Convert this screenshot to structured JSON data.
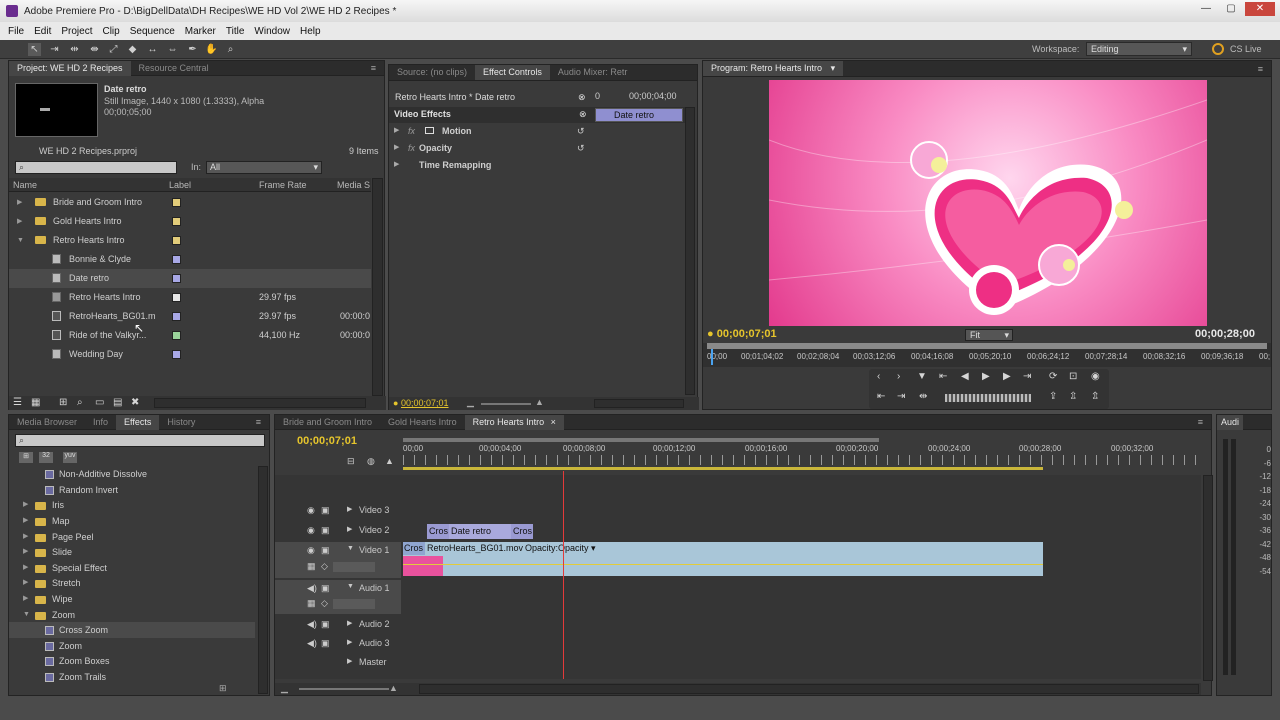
{
  "window": {
    "title": "Adobe Premiere Pro - D:\\BigDellData\\DH Recipes\\WE HD Vol 2\\WE HD 2 Recipes *"
  },
  "menu": [
    "File",
    "Edit",
    "Project",
    "Clip",
    "Sequence",
    "Marker",
    "Title",
    "Window",
    "Help"
  ],
  "workspace": {
    "label": "Workspace:",
    "value": "Editing",
    "cslive": "CS Live"
  },
  "project": {
    "tabs": [
      "Project: WE HD 2 Recipes",
      "Resource Central"
    ],
    "preview": {
      "name": "Date retro",
      "info": "Still Image, 1440 x 1080 (1.3333), Alpha",
      "duration": "00;00;05;00"
    },
    "file": "WE HD 2 Recipes.prproj",
    "count": "9 Items",
    "in_label": "In:",
    "in_value": "All",
    "columns": [
      "Name",
      "Label",
      "Frame Rate",
      "Media S"
    ],
    "items": [
      {
        "name": "Bride and Groom Intro",
        "rate": "",
        "media": ""
      },
      {
        "name": "Gold Hearts Intro",
        "rate": "",
        "media": ""
      },
      {
        "name": "Retro Hearts Intro",
        "rate": "",
        "media": ""
      },
      {
        "name": "Bonnie & Clyde",
        "rate": "",
        "media": ""
      },
      {
        "name": "Date retro",
        "rate": "",
        "media": ""
      },
      {
        "name": "Retro Hearts Intro",
        "rate": "29.97 fps",
        "media": ""
      },
      {
        "name": "RetroHearts_BG01.m",
        "rate": "29.97 fps",
        "media": "00:00:0"
      },
      {
        "name": "Ride of the Valkyr...",
        "rate": "44,100 Hz",
        "media": "00:00:0"
      },
      {
        "name": "Wedding Day",
        "rate": "",
        "media": ""
      }
    ]
  },
  "effect_controls": {
    "tabs": [
      "Source: (no clips)",
      "Effect Controls",
      "Audio Mixer: Retr"
    ],
    "clip_path": "Retro Hearts Intro * Date retro",
    "time_start": "0",
    "time_end": "00;00;04;00",
    "clip_label": "Date retro",
    "section": "Video Effects",
    "effects": [
      "Motion",
      "Opacity",
      "Time Remapping"
    ],
    "timecode": "00;00;07;01"
  },
  "program": {
    "tab": "Program: Retro Hearts Intro",
    "timecode": "00;00;07;01",
    "fit": "Fit",
    "duration": "00;00;28;00",
    "ruler": [
      "00;00",
      "00;01;04;02",
      "00;02;08;04",
      "00;03;12;06",
      "00;04;16;08",
      "00;05;20;10",
      "00;06;24;12",
      "00;07;28;14",
      "00;08;32;16",
      "00;09;36;18",
      "00;"
    ]
  },
  "effects": {
    "tabs": [
      "Media Browser",
      "Info",
      "Effects",
      "History"
    ],
    "items": [
      {
        "name": "Non-Additive Dissolve",
        "type": "fx"
      },
      {
        "name": "Random Invert",
        "type": "fx"
      },
      {
        "name": "Iris",
        "type": "folder"
      },
      {
        "name": "Map",
        "type": "folder"
      },
      {
        "name": "Page Peel",
        "type": "folder"
      },
      {
        "name": "Slide",
        "type": "folder"
      },
      {
        "name": "Special Effect",
        "type": "folder"
      },
      {
        "name": "Stretch",
        "type": "folder"
      },
      {
        "name": "Wipe",
        "type": "folder"
      },
      {
        "name": "Zoom",
        "type": "folder-open"
      },
      {
        "name": "Cross Zoom",
        "type": "fx"
      },
      {
        "name": "Zoom",
        "type": "fx"
      },
      {
        "name": "Zoom Boxes",
        "type": "fx"
      },
      {
        "name": "Zoom Trails",
        "type": "fx"
      }
    ]
  },
  "timeline": {
    "tabs": [
      "Bride and Groom Intro",
      "Gold Hearts Intro",
      "Retro Hearts Intro"
    ],
    "timecode": "00;00;07;01",
    "ruler": [
      "00;00",
      "00;00;04;00",
      "00;00;08;00",
      "00;00;12;00",
      "00;00;16;00",
      "00;00;20;00",
      "00;00;24;00",
      "00;00;28;00",
      "00;00;32;00"
    ],
    "tracks": [
      "Video 3",
      "Video 2",
      "Video 1",
      "Audio 1",
      "Audio 2",
      "Audio 3",
      "Master"
    ],
    "clips": {
      "v2a": "Cros",
      "v2b": "Date retro",
      "v2c": "Cros",
      "v1a": "Cros",
      "v1b": "RetroHearts_BG01.mov",
      "v1c": "Opacity:Opacity"
    }
  },
  "audio_meter": {
    "tab": "Audi",
    "scale": [
      "0",
      "-6",
      "-12",
      "-18",
      "-24",
      "-30",
      "-36",
      "-42",
      "-48",
      "-54"
    ]
  }
}
